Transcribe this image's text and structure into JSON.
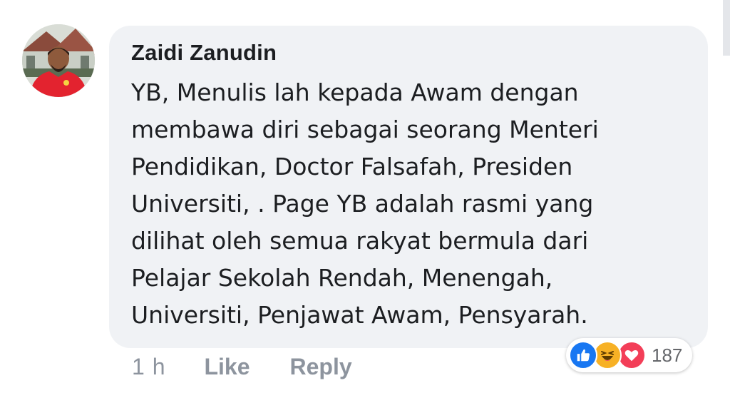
{
  "comment": {
    "author": "Zaidi Zanudin",
    "lines": [
      "YB, Menulis lah kepada Awam dengan",
      "membawa diri sebagai seorang Menteri",
      "Pendidikan, Doctor Falsafah, Presiden",
      "Universiti, . Page YB adalah rasmi yang",
      "dilihat oleh semua rakyat bermula dari",
      "Pelajar Sekolah Rendah, Menengah,",
      "Universiti, Penjawat Awam, Pensyarah."
    ],
    "time": "1 h",
    "like_label": "Like",
    "reply_label": "Reply",
    "reactions": {
      "icons": [
        "like-icon",
        "haha-icon",
        "love-icon"
      ],
      "count": "187"
    }
  },
  "colors": {
    "bubble": "#f0f2f5",
    "author_text": "#1c1e21",
    "meta_text": "#8d949e",
    "like_blue": "#1877f2",
    "haha_yellow": "#f7b125",
    "love_red": "#f33e58"
  }
}
